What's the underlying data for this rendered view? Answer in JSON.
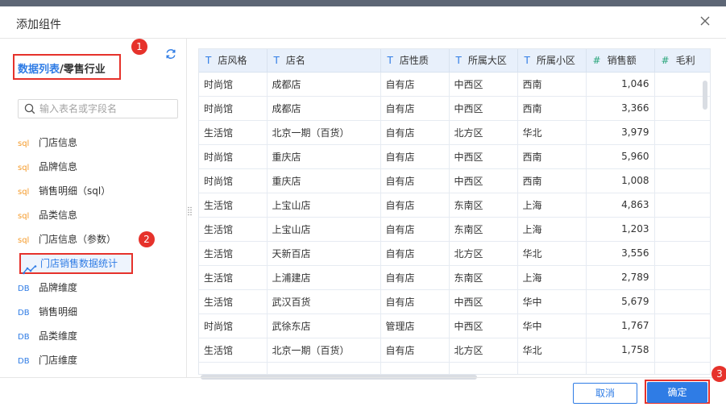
{
  "dialog": {
    "title": "添加组件",
    "close_icon": "close-icon"
  },
  "breadcrumb": {
    "link": "数据列表",
    "separator": "/",
    "current": "零售行业"
  },
  "search": {
    "placeholder": "输入表名或字段名"
  },
  "sources": [
    {
      "type": "sql",
      "label": "门店信息"
    },
    {
      "type": "sql",
      "label": "品牌信息"
    },
    {
      "type": "sql",
      "label": "销售明细（sql）"
    },
    {
      "type": "sql",
      "label": "品类信息"
    },
    {
      "type": "sql",
      "label": "门店信息（参数）"
    },
    {
      "type": "line-chart-icon",
      "label": "门店销售数据统计"
    },
    {
      "type": "DB",
      "label": "品牌维度"
    },
    {
      "type": "DB",
      "label": "销售明细"
    },
    {
      "type": "DB",
      "label": "品类维度"
    },
    {
      "type": "DB",
      "label": "门店维度"
    }
  ],
  "source_tags": {
    "sql": "sql",
    "db": "DB"
  },
  "badges": [
    "1",
    "2",
    "3"
  ],
  "table": {
    "columns": [
      {
        "type": "T",
        "label": "店风格"
      },
      {
        "type": "T",
        "label": "店名"
      },
      {
        "type": "T",
        "label": "店性质"
      },
      {
        "type": "T",
        "label": "所属大区"
      },
      {
        "type": "T",
        "label": "所属小区"
      },
      {
        "type": "#",
        "label": "销售额"
      },
      {
        "type": "#",
        "label": "毛利"
      }
    ],
    "rows": [
      [
        "时尚馆",
        "成都店",
        "自有店",
        "中西区",
        "西南",
        "1,046",
        ""
      ],
      [
        "时尚馆",
        "成都店",
        "自有店",
        "中西区",
        "西南",
        "3,366",
        ""
      ],
      [
        "生活馆",
        "北京一期（百货）",
        "自有店",
        "北方区",
        "华北",
        "3,979",
        ""
      ],
      [
        "时尚馆",
        "重庆店",
        "自有店",
        "中西区",
        "西南",
        "5,960",
        ""
      ],
      [
        "时尚馆",
        "重庆店",
        "自有店",
        "中西区",
        "西南",
        "1,008",
        ""
      ],
      [
        "生活馆",
        "上宝山店",
        "自有店",
        "东南区",
        "上海",
        "4,863",
        ""
      ],
      [
        "生活馆",
        "上宝山店",
        "自有店",
        "东南区",
        "上海",
        "1,203",
        ""
      ],
      [
        "生活馆",
        "天新百店",
        "自有店",
        "北方区",
        "华北",
        "3,556",
        ""
      ],
      [
        "生活馆",
        "上浦建店",
        "自有店",
        "东南区",
        "上海",
        "2,789",
        ""
      ],
      [
        "生活馆",
        "武汉百货",
        "自有店",
        "中西区",
        "华中",
        "5,679",
        ""
      ],
      [
        "时尚馆",
        "武徐东店",
        "管理店",
        "中西区",
        "华中",
        "1,767",
        ""
      ],
      [
        "生活馆",
        "北京一期（百货）",
        "自有店",
        "北方区",
        "华北",
        "1,758",
        ""
      ],
      [
        "",
        "",
        "",
        "",
        "",
        "",
        ""
      ]
    ]
  },
  "footer": {
    "cancel": "取消",
    "ok": "确定"
  },
  "colors": {
    "accent": "#2f7ce5",
    "highlight": "#e6322b",
    "sql_tag": "#f59b2a",
    "number_type": "#28a57a"
  }
}
